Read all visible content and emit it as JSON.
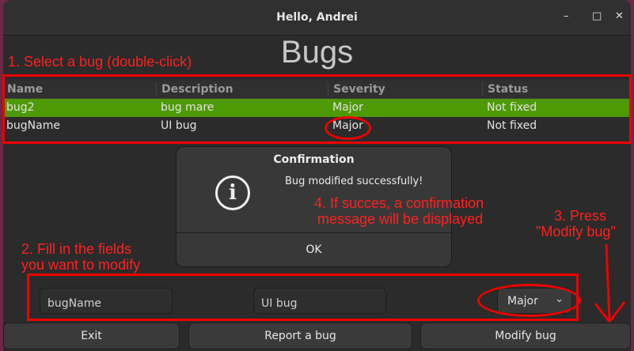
{
  "window": {
    "title": "Hello, Andrei",
    "minimize": "–",
    "maximize": "□",
    "close": "✕"
  },
  "page": {
    "title": "Bugs"
  },
  "table": {
    "columns": [
      "Name",
      "Description",
      "Severity",
      "Status"
    ],
    "rows": [
      {
        "name": "bug2",
        "description": "bug mare",
        "severity": "Major",
        "status": "Not fixed"
      },
      {
        "name": "bugName",
        "description": "UI bug",
        "severity": "Major",
        "status": "Not fixed"
      }
    ]
  },
  "dialog": {
    "title": "Confirmation",
    "icon": "info-icon",
    "icon_glyph": "i",
    "message": "Bug modified successfully!",
    "ok_label": "OK"
  },
  "form": {
    "name_value": "bugName",
    "description_value": "UI bug",
    "severity_value": "Major",
    "chevron": "⌄"
  },
  "buttons": {
    "exit": "Exit",
    "report": "Report a bug",
    "modify": "Modify bug"
  },
  "annotations": {
    "step1": "1. Select a bug (double-click)",
    "step2_line1": "2. Fill in the fields",
    "step2_line2": "you want to modify",
    "step3_line1": "3. Press",
    "step3_line2": "\"Modify bug\"",
    "step4_line1": "4. If succes, a confirmation",
    "step4_line2": "message will be displayed",
    "color": "#ff2020"
  },
  "colors": {
    "selected_row": "#4e9a06",
    "window_bg": "#2b2b2b",
    "desktop_bg": "#6a2946"
  }
}
